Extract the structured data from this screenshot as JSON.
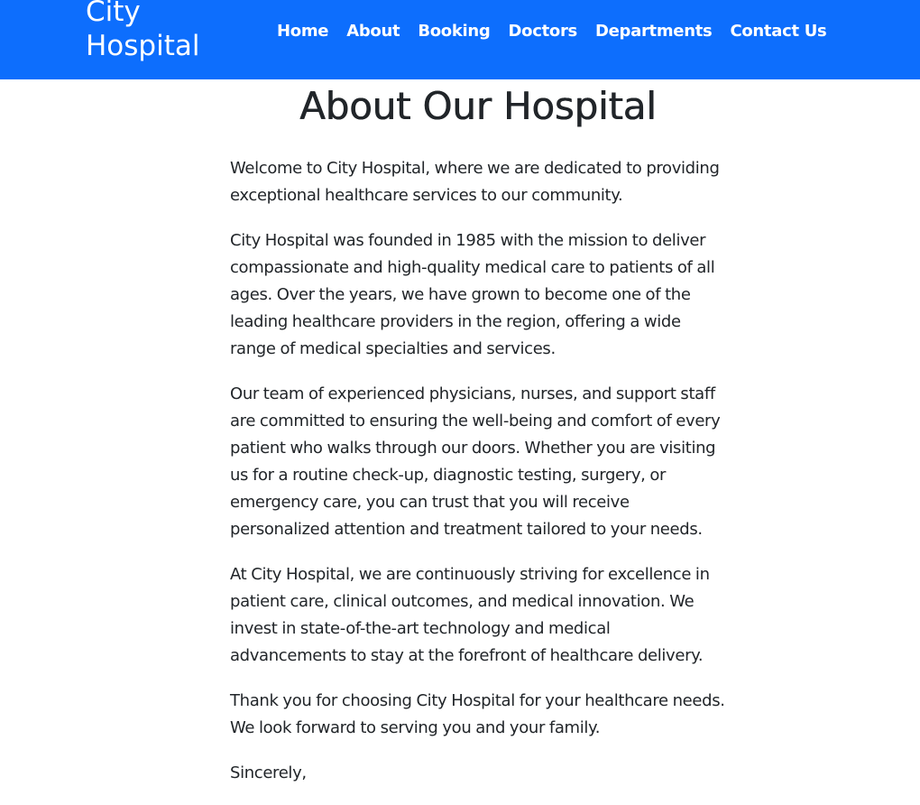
{
  "navbar": {
    "brand": "City\nHospital",
    "links": [
      "Home",
      "About",
      "Booking",
      "Doctors",
      "Departments",
      "Contact Us"
    ],
    "background": "#0d6efd"
  },
  "main": {
    "title": "About Our Hospital",
    "paragraphs": [
      "Welcome to City Hospital, where we are dedicated to providing exceptional healthcare services to our community.",
      "City Hospital was founded in 1985 with the mission to deliver compassionate and high-quality medical care to patients of all ages. Over the years, we have grown to become one of the leading healthcare providers in the region, offering a wide range of medical specialties and services.",
      "Our team of experienced physicians, nurses, and support staff are committed to ensuring the well-being and comfort of every patient who walks through our doors. Whether you are visiting us for a routine check-up, diagnostic testing, surgery, or emergency care, you can trust that you will receive personalized attention and treatment tailored to your needs.",
      "At City Hospital, we are continuously striving for excellence in patient care, clinical outcomes, and medical innovation. We invest in state-of-the-art technology and medical advancements to stay at the forefront of healthcare delivery.",
      "Thank you for choosing City Hospital for your healthcare needs. We look forward to serving you and your family.",
      "Sincerely,"
    ]
  }
}
